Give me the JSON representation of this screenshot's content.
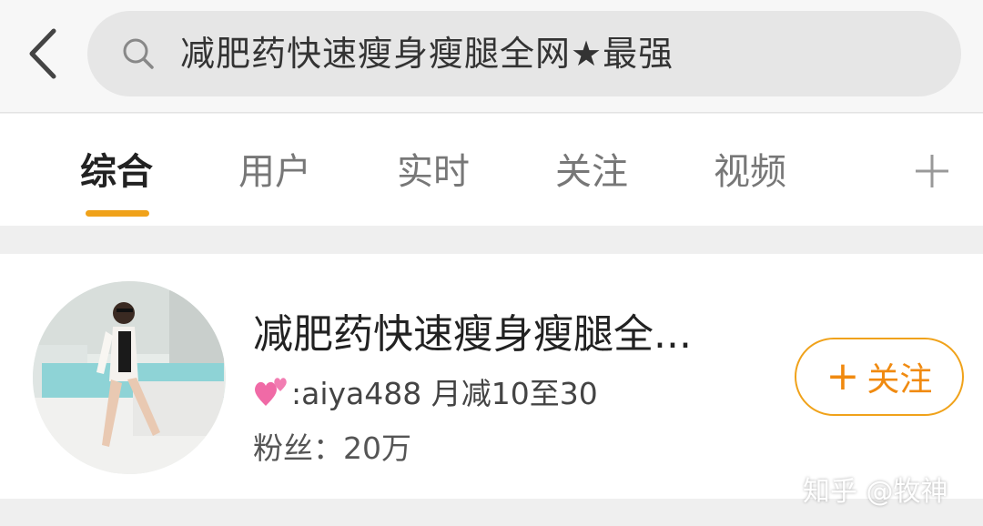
{
  "search": {
    "query": "减肥药快速瘦身瘦腿全网★最强"
  },
  "tabs": [
    {
      "label": "综合",
      "active": true
    },
    {
      "label": "用户",
      "active": false
    },
    {
      "label": "实时",
      "active": false
    },
    {
      "label": "关注",
      "active": false
    },
    {
      "label": "视频",
      "active": false
    }
  ],
  "result": {
    "name": "减肥药快速瘦身瘦腿全...",
    "description": ":aiya488 月减10至30",
    "fans": "粉丝：20万",
    "follow_label": "关注",
    "follow_plus": "+"
  },
  "watermark": "知乎 @牧神",
  "colors": {
    "accent": "#f0a21a",
    "follow_text": "#f08a10",
    "heart": "#f06aa6"
  },
  "icons": {
    "back": "chevron-left-icon",
    "search": "search-icon",
    "more_tabs": "plus-icon",
    "heart": "two-hearts-icon"
  }
}
